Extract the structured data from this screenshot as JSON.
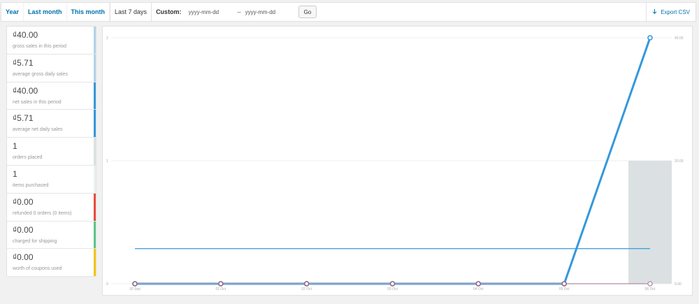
{
  "toolbar": {
    "ranges": [
      "Year",
      "Last month",
      "This month",
      "Last 7 days"
    ],
    "custom_label": "Custom:",
    "start_placeholder": "yyyy-mm-dd",
    "separator": "–",
    "end_placeholder": "yyyy-mm-dd",
    "go_label": "Go",
    "export_label": "Export CSV"
  },
  "legend": [
    {
      "amount": "₫40.00",
      "desc": "gross sales in this period",
      "color": "#b1d4ea"
    },
    {
      "amount": "₫5.71",
      "desc": "average gross daily sales",
      "color": "#b1d4ea"
    },
    {
      "amount": "₫40.00",
      "desc": "net sales in this period",
      "color": "#3498db"
    },
    {
      "amount": "₫5.71",
      "desc": "average net daily sales",
      "color": "#3498db"
    },
    {
      "amount": "1",
      "desc": "orders placed",
      "color": "#dbe1e3"
    },
    {
      "amount": "1",
      "desc": "items purchased",
      "color": "#ecf0f1"
    },
    {
      "amount": "₫0.00",
      "desc": "refunded 0 orders (0 items)",
      "color": "#e74c3c"
    },
    {
      "amount": "₫0.00",
      "desc": "charged for shipping",
      "color": "#5cc488"
    },
    {
      "amount": "₫0.00",
      "desc": "worth of coupons used",
      "color": "#f1c40f"
    }
  ],
  "chart_data": {
    "type": "line",
    "categories": [
      "30 Sep",
      "01 Oct",
      "02 Oct",
      "03 Oct",
      "04 Oct",
      "05 Oct",
      "06 Oct"
    ],
    "y_left_ticks": [
      "0",
      "1",
      "2"
    ],
    "y_left_range": [
      0,
      2
    ],
    "y_right_ticks": [
      "0.00",
      "20.00",
      "40.00"
    ],
    "y_right_range": [
      0,
      40
    ],
    "series": [
      {
        "kind": "bar",
        "axis": "left",
        "values": [
          0,
          0,
          0,
          0,
          0,
          0,
          1
        ],
        "color": "#dbe1e3"
      },
      {
        "kind": "line",
        "axis": "right",
        "values": [
          0,
          0,
          0,
          0,
          0,
          0,
          40
        ],
        "color": "#3498db"
      },
      {
        "kind": "line",
        "axis": "right",
        "values": [
          0,
          0,
          0,
          0,
          0,
          0,
          0
        ],
        "color": "#e74c3c"
      },
      {
        "kind": "line",
        "axis": "left",
        "values": [
          0,
          0,
          0,
          0,
          0,
          0,
          0
        ],
        "color": "#b9a3c4"
      },
      {
        "kind": "hline",
        "axis": "right",
        "value": 5.71,
        "color": "#3498db"
      }
    ],
    "grid": true
  }
}
